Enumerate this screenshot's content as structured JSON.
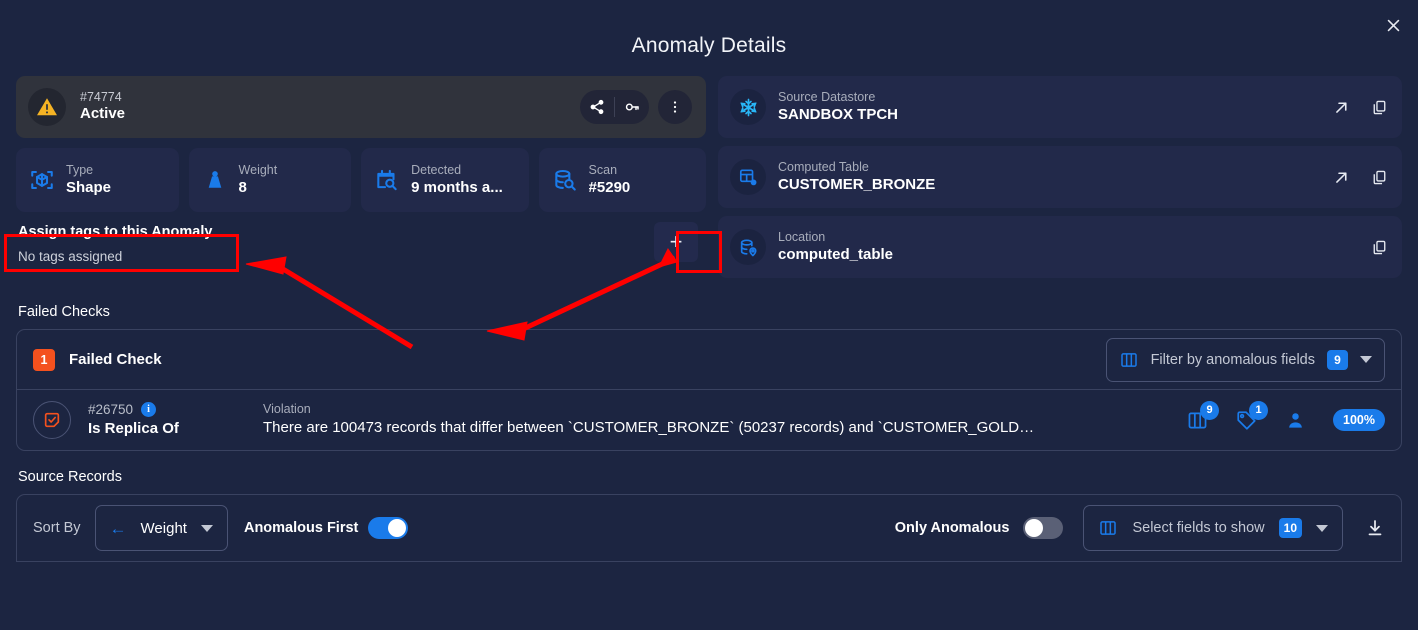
{
  "header": {
    "title": "Anomaly Details",
    "close_icon": "close-icon"
  },
  "status": {
    "icon": "warning-triangle-icon",
    "id": "#74774",
    "state": "Active",
    "actions": [
      {
        "name": "share-button",
        "icon": "share-icon"
      },
      {
        "name": "key-button",
        "icon": "key-icon"
      },
      {
        "name": "more-options-button",
        "icon": "kebab-menu-icon"
      }
    ]
  },
  "tiles": [
    {
      "key": "Type",
      "value": "Shape",
      "icon": "cube-scan-icon"
    },
    {
      "key": "Weight",
      "value": "8",
      "icon": "weight-icon"
    },
    {
      "key": "Detected",
      "value": "9 months a...",
      "icon": "calendar-search-icon"
    },
    {
      "key": "Scan",
      "value": "#5290",
      "icon": "database-search-icon"
    }
  ],
  "tags": {
    "title": "Assign tags to this Anomaly",
    "empty_text": "No tags assigned",
    "add_label": "+"
  },
  "info_cards": [
    {
      "key": "Source Datastore",
      "value": "SANDBOX TPCH",
      "icon": "snowflake-icon",
      "actions": [
        "open-external-icon",
        "copy-icon"
      ]
    },
    {
      "key": "Computed Table",
      "value": "CUSTOMER_BRONZE",
      "icon": "table-settings-icon",
      "actions": [
        "open-external-icon",
        "copy-icon"
      ]
    },
    {
      "key": "Location",
      "value": "computed_table",
      "icon": "database-location-icon",
      "actions": [
        "copy-icon"
      ]
    }
  ],
  "failed_checks": {
    "section_title": "Failed Checks",
    "count": "1",
    "header_label": "Failed Check",
    "filter": {
      "icon": "columns-icon",
      "label": "Filter by anomalous fields",
      "count": "9",
      "caret": "chevron-down-icon"
    },
    "row": {
      "status_icon": "check-square-icon",
      "id": "#26750",
      "info_icon": "i",
      "name": "Is Replica Of",
      "violation_key": "Violation",
      "violation_text": "There are 100473 records that differ between `CUSTOMER_BRONZE` (50237 records) and `CUSTOMER_GOLD…",
      "metrics": [
        {
          "name": "fields-metric",
          "icon": "columns-icon",
          "badge": "9"
        },
        {
          "name": "tags-metric",
          "icon": "tag-icon",
          "badge": "1"
        },
        {
          "name": "assignee-metric",
          "icon": "person-icon",
          "badge": ""
        }
      ],
      "percent": "100%"
    }
  },
  "source_records": {
    "section_title": "Source Records",
    "sort_by_label": "Sort By",
    "sort_value": "Weight",
    "sort_direction_icon": "arrow-left-icon",
    "sort_caret": "chevron-down-icon",
    "anomalous_first_label": "Anomalous First",
    "anomalous_first_on": true,
    "only_anomalous_label": "Only Anomalous",
    "only_anomalous_on": false,
    "fields_select": {
      "icon": "columns-icon",
      "label": "Select fields to show",
      "count": "10",
      "caret": "chevron-down-icon"
    },
    "download_icon": "download-icon"
  },
  "colors": {
    "background": "#1c2541",
    "card": "#22294a",
    "status_card": "#30333c",
    "accent_blue": "#1a7bea",
    "warning_amber": "#f5b324",
    "danger_orange": "#f4511e",
    "annotation_red": "#ff0000",
    "border": "#394260",
    "muted_text": "#a8adbb"
  }
}
